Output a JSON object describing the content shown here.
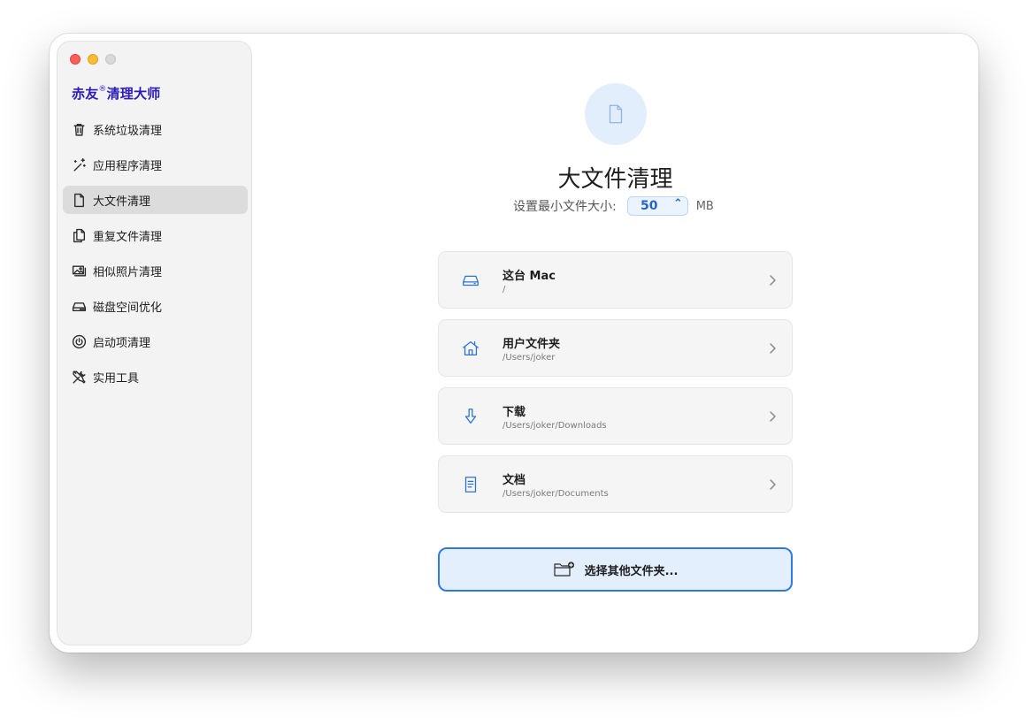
{
  "sidebar": {
    "brand_main": "赤友",
    "brand_mark": "®",
    "brand_tail": "清理大师",
    "items": [
      {
        "label": "系统垃圾清理",
        "icon": "trash-icon"
      },
      {
        "label": "应用程序清理",
        "icon": "magic-wand-icon"
      },
      {
        "label": "大文件清理",
        "icon": "document-icon",
        "active": true
      },
      {
        "label": "重复文件清理",
        "icon": "duplicate-documents-icon"
      },
      {
        "label": "相似照片清理",
        "icon": "photos-icon"
      },
      {
        "label": "磁盘空间优化",
        "icon": "disk-drive-icon"
      },
      {
        "label": "启动项清理",
        "icon": "power-icon"
      },
      {
        "label": "实用工具",
        "icon": "tools-icon"
      }
    ]
  },
  "main": {
    "title": "大文件清理",
    "min_size_label": "设置最小文件大小:",
    "min_size_value": "50",
    "stepper_glyph": "⌃",
    "min_size_unit": "MB",
    "locations": [
      {
        "name": "这台 Mac",
        "path": "/",
        "icon": "drive-icon"
      },
      {
        "name": "用户文件夹",
        "path": "/Users/joker",
        "icon": "home-icon"
      },
      {
        "name": "下载",
        "path": "/Users/joker/Downloads",
        "icon": "download-arrow-icon"
      },
      {
        "name": "文档",
        "path": "/Users/joker/Documents",
        "icon": "document-text-icon"
      }
    ],
    "choose_folder_label": "选择其他文件夹..."
  },
  "colors": {
    "accent": "#2c73d6",
    "brand": "#2a1bb8",
    "active_nav_bg": "#dcdcdc",
    "choose_button_bg": "#e4effd"
  }
}
